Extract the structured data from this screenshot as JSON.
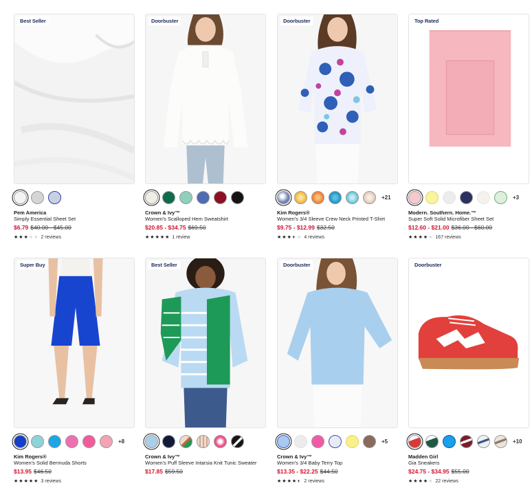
{
  "products": [
    {
      "badge": "Best Seller",
      "brand": "Pem America",
      "name": "Simply Essential Sheet Set",
      "sale": "$6.79",
      "orig": "$40.00 - $45.00",
      "stars": 3,
      "reviews": "2 reviews",
      "swatches": [
        "#f4f4f4",
        "#d5d5d5",
        "#c7d1e3"
      ],
      "more": "",
      "image_icon": "white-sheets-image"
    },
    {
      "badge": "Doorbuster",
      "brand": "Crown & Ivy™",
      "name": "Women's Scalloped Hem Sweatshirt",
      "sale": "$20.85 - $34.75",
      "orig": "$69.50",
      "stars": 5,
      "reviews": "1 review",
      "swatches": [
        "#f0ede4",
        "#0f6b4e",
        "#8fcfbd",
        "#4f6cb2",
        "#8c0f24",
        "#141414"
      ],
      "more": "",
      "image_icon": "white-sweatshirt-image"
    },
    {
      "badge": "Doorbuster",
      "brand": "Kim Rogers®",
      "name": "Women's 3/4 Sleeve Crew Neck Printed T-Shirt",
      "sale": "$9.75 - $12.99",
      "orig": "$32.50",
      "stars": 3.5,
      "reviews": "4 reviews",
      "swatches": [
        "#6d7fb6",
        "#f2b233",
        "#f07a2a",
        "#1e8fc1",
        "#5fc2d6",
        "#e0c9b8"
      ],
      "more": "+21",
      "image_icon": "paisley-tshirt-image"
    },
    {
      "badge": "Top Rated",
      "brand": "Modern. Southern. Home.™",
      "name": "Super Soft Solid Microfiber Sheet Set",
      "sale": "$12.60 - $21.00",
      "orig": "$36.00 - $60.00",
      "stars": 4,
      "reviews": "167 reviews",
      "swatches": [
        "#f7c9cc",
        "#f8f4a0",
        "#ececec",
        "#2a3160",
        "#f4f2ec",
        "#dfeede"
      ],
      "more": "+3",
      "image_icon": "pink-sheet-set-image"
    },
    {
      "badge": "Super Buy",
      "brand": "Kim Rogers®",
      "name": "Women's Solid Bermuda Shorts",
      "sale": "$13.95",
      "orig": "$46.50",
      "stars": 5,
      "reviews": "3 reviews",
      "swatches": [
        "#1540c6",
        "#8fd3d9",
        "#1ba6e6",
        "#ef6fb3",
        "#f25c9b",
        "#f3a4b4"
      ],
      "more": "+8",
      "image_icon": "blue-shorts-image"
    },
    {
      "badge": "Best Seller",
      "brand": "Crown & Ivy™",
      "name": "Women's Puff Sleeve Intarsia Knit Tunic Sweater",
      "sale": "$17.85",
      "orig": "$59.50",
      "stars": 5,
      "reviews": "",
      "swatches": [
        "#a8cfe8",
        "#111a3a",
        "#c8643a",
        "#e9dcd0",
        "#ef4f8b",
        "#161616"
      ],
      "more": "",
      "image_icon": "green-striped-sweater-image"
    },
    {
      "badge": "Doorbuster",
      "brand": "Crown & Ivy™",
      "name": "Women's 3/4 Baby Terry Top",
      "sale": "$13.35 - $22.25",
      "orig": "$44.50",
      "stars": 4.5,
      "reviews": "2 reviews",
      "swatches": [
        "#aac9ee",
        "#ececec",
        "#f25aa6",
        "#e8eaf4",
        "#f8f08a",
        "#8a6a5c"
      ],
      "more": "+5",
      "image_icon": "light-blue-top-image"
    },
    {
      "badge": "Doorbuster",
      "brand": "Madden Girl",
      "name": "Gia Sneakers",
      "sale": "$24.75 - $34.95",
      "orig": "$55.00",
      "stars": 4,
      "reviews": "22 reviews",
      "swatches": [
        "#d83a3a",
        "#1d5a45",
        "#1aa0e8",
        "#7a1e2a",
        "#b7c4d6",
        "#c8b8a8"
      ],
      "more": "+10",
      "image_icon": "red-sneaker-image"
    }
  ]
}
